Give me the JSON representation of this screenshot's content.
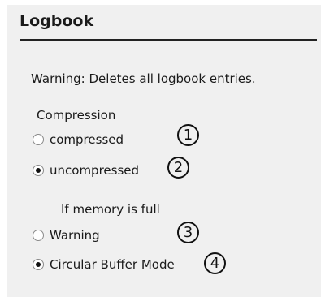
{
  "section": {
    "title": "Logbook",
    "warning": "Warning: Deletes all logbook entries."
  },
  "compression": {
    "label": "Compression",
    "options": [
      {
        "label": "compressed",
        "checked": false,
        "marker": "1"
      },
      {
        "label": "uncompressed",
        "checked": true,
        "marker": "2"
      }
    ]
  },
  "memory_full": {
    "label": "If memory is full",
    "options": [
      {
        "label": "Warning",
        "checked": false,
        "marker": "3"
      },
      {
        "label": "Circular Buffer Mode",
        "checked": true,
        "marker": "4"
      }
    ]
  }
}
